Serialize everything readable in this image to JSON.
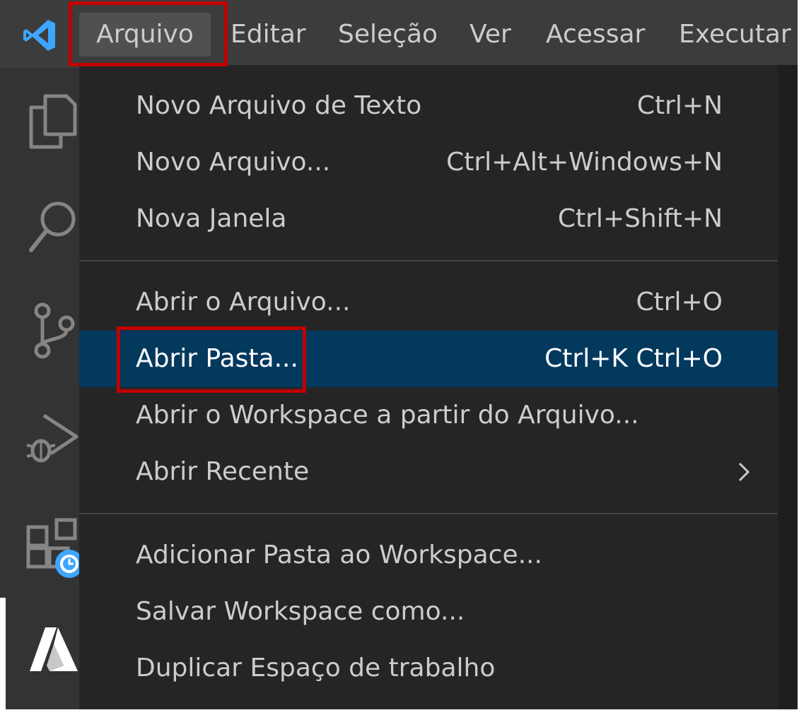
{
  "menubar": {
    "items": [
      {
        "label": "Arquivo"
      },
      {
        "label": "Editar"
      },
      {
        "label": "Seleção"
      },
      {
        "label": "Ver"
      },
      {
        "label": "Acessar"
      },
      {
        "label": "Executar"
      }
    ]
  },
  "activity_icons": [
    "explorer-icon",
    "search-icon",
    "source-control-icon",
    "run-debug-icon",
    "extensions-icon",
    "azure-icon"
  ],
  "file_menu": {
    "groups": [
      [
        {
          "label": "Novo Arquivo de Texto",
          "shortcut": "Ctrl+N"
        },
        {
          "label": "Novo Arquivo...",
          "shortcut": "Ctrl+Alt+Windows+N"
        },
        {
          "label": "Nova Janela",
          "shortcut": "Ctrl+Shift+N"
        }
      ],
      [
        {
          "label": "Abrir o Arquivo...",
          "shortcut": "Ctrl+O"
        },
        {
          "label": "Abrir Pasta...",
          "shortcut": "Ctrl+K Ctrl+O",
          "selected": true
        },
        {
          "label": "Abrir o Workspace a partir do Arquivo...",
          "shortcut": ""
        },
        {
          "label": "Abrir Recente",
          "shortcut": "",
          "submenu": true
        }
      ],
      [
        {
          "label": "Adicionar Pasta ao Workspace...",
          "shortcut": ""
        },
        {
          "label": "Salvar Workspace como...",
          "shortcut": ""
        },
        {
          "label": "Duplicar Espaço de trabalho",
          "shortcut": ""
        }
      ]
    ]
  },
  "colors": {
    "titlebar": "#3c3c3c",
    "menu_bg": "#252526",
    "selection": "#04395e",
    "highlight_box": "#c00000",
    "vscode_blue": "#3ea6ff"
  }
}
